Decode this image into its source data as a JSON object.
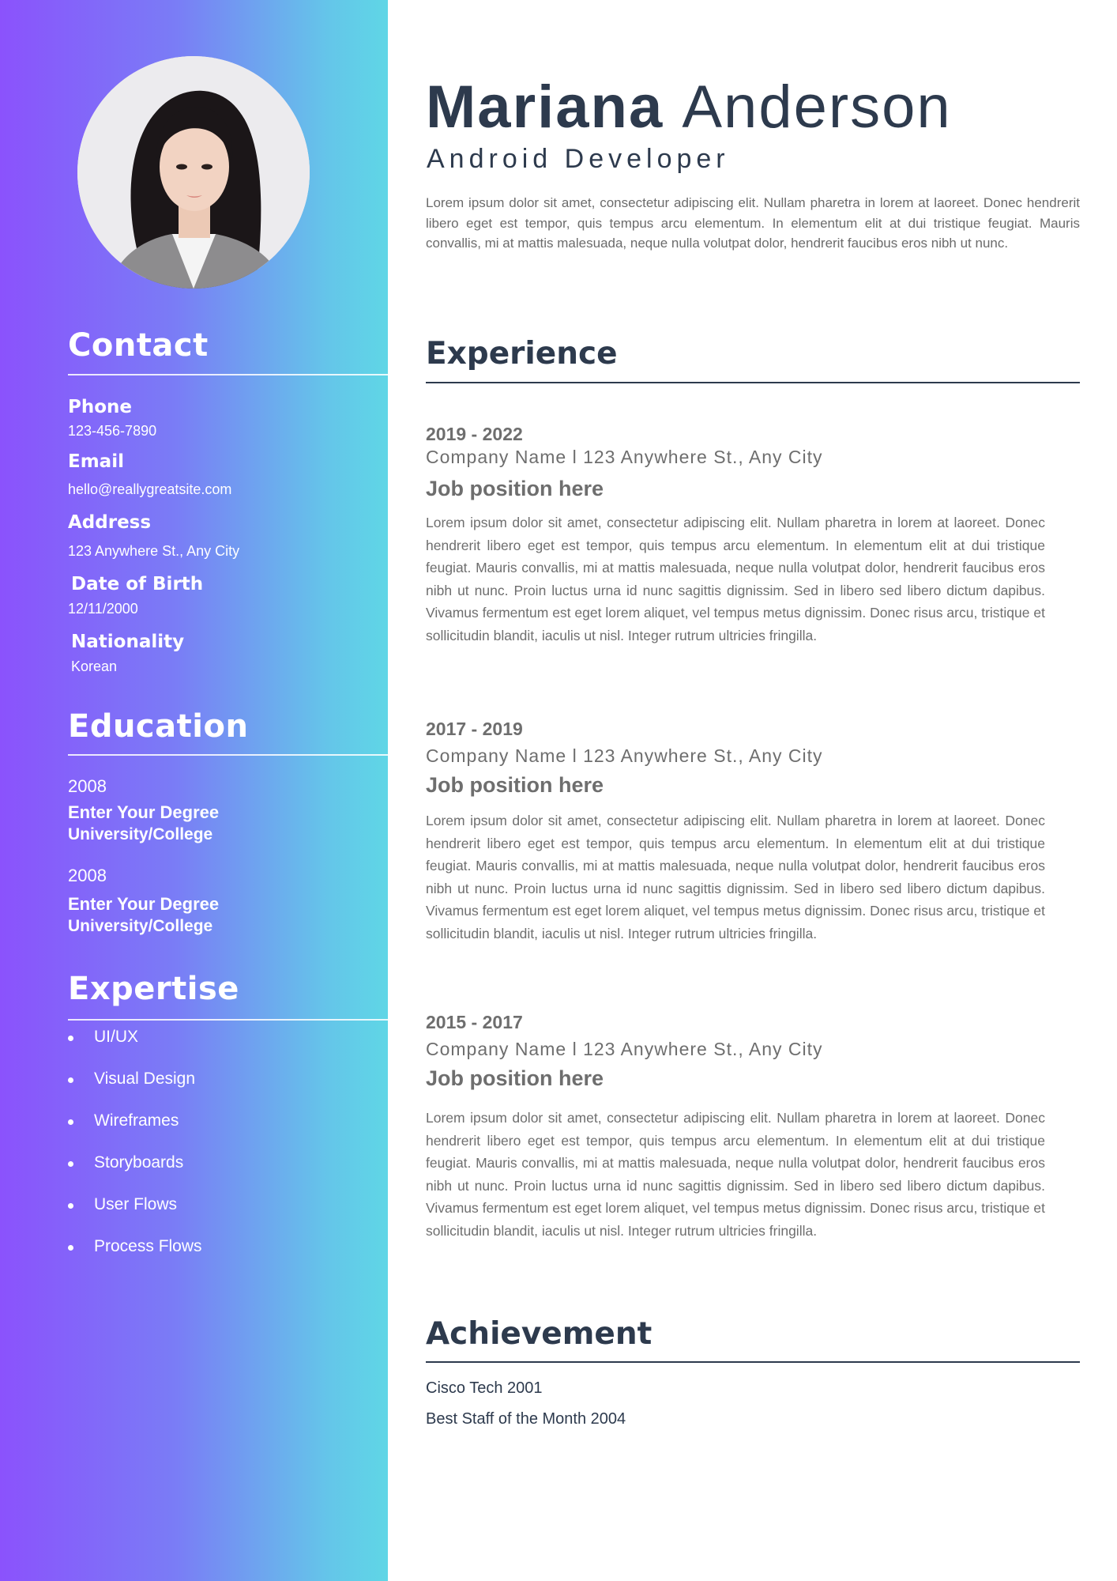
{
  "profile": {
    "first_name": "Mariana",
    "last_name": "Anderson",
    "role": "Android Developer",
    "summary": "Lorem ipsum dolor sit amet, consectetur adipiscing elit. Nullam pharetra in lorem at laoreet. Donec hendrerit libero eget est tempor, quis tempus arcu elementum. In elementum elit at dui tristique feugiat. Mauris convallis, mi at mattis malesuada, neque nulla volutpat dolor, hendrerit faucibus eros nibh ut nunc."
  },
  "contact": {
    "title": "Contact",
    "phone_label": "Phone",
    "phone": "123-456-7890",
    "email_label": "Email",
    "email": "hello@reallygreatsite.com",
    "address_label": "Address",
    "address": "123 Anywhere St., Any City",
    "dob_label": "Date of Birth",
    "dob": "12/11/2000",
    "nationality_label": "Nationality",
    "nationality": "Korean"
  },
  "education": {
    "title": "Education",
    "items": [
      {
        "year": "2008",
        "degree": "Enter Your Degree",
        "school": "University/College"
      },
      {
        "year": "2008",
        "degree": "Enter Your Degree",
        "school": "University/College"
      }
    ]
  },
  "expertise": {
    "title": "Expertise",
    "items": [
      "UI/UX",
      "Visual Design",
      "Wireframes",
      "Storyboards",
      "User Flows",
      "Process Flows"
    ]
  },
  "experience": {
    "title": "Experience",
    "jobs": [
      {
        "years": "2019 - 2022",
        "company": "Company Name l 123 Anywhere St., Any City",
        "position": "Job position here",
        "description": "Lorem ipsum dolor sit amet, consectetur adipiscing elit. Nullam pharetra in lorem at laoreet. Donec hendrerit libero eget est tempor, quis tempus arcu elementum. In elementum elit at dui tristique feugiat. Mauris convallis, mi at mattis malesuada, neque nulla volutpat dolor, hendrerit faucibus eros nibh ut nunc. Proin luctus urna id nunc sagittis dignissim. Sed in libero sed libero dictum dapibus. Vivamus fermentum est eget lorem aliquet, vel tempus metus dignissim. Donec risus arcu, tristique et sollicitudin blandit, iaculis ut nisl. Integer rutrum ultricies fringilla."
      },
      {
        "years": "2017 - 2019",
        "company": "Company Name l 123 Anywhere St., Any City",
        "position": "Job position here",
        "description": "Lorem ipsum dolor sit amet, consectetur adipiscing elit. Nullam pharetra in lorem at laoreet. Donec hendrerit libero eget est tempor, quis tempus arcu elementum. In elementum elit at dui tristique feugiat. Mauris convallis, mi at mattis malesuada, neque nulla volutpat dolor, hendrerit faucibus eros nibh ut nunc. Proin luctus urna id nunc sagittis dignissim. Sed in libero sed libero dictum dapibus. Vivamus fermentum est eget lorem aliquet, vel tempus metus dignissim. Donec risus arcu, tristique et sollicitudin blandit, iaculis ut nisl. Integer rutrum ultricies fringilla."
      },
      {
        "years": "2015 - 2017",
        "company": "Company Name l 123 Anywhere St., Any City",
        "position": "Job position here",
        "description": "Lorem ipsum dolor sit amet, consectetur adipiscing elit. Nullam pharetra in lorem at laoreet. Donec hendrerit libero eget est tempor, quis tempus arcu elementum. In elementum elit at dui tristique feugiat. Mauris convallis, mi at mattis malesuada, neque nulla volutpat dolor, hendrerit faucibus eros nibh ut nunc. Proin luctus urna id nunc sagittis dignissim. Sed in libero sed libero dictum dapibus. Vivamus fermentum est eget lorem aliquet, vel tempus metus dignissim. Donec risus arcu, tristique et sollicitudin blandit, iaculis ut nisl. Integer rutrum ultricies fringilla."
      }
    ]
  },
  "achievement": {
    "title": "Achievement",
    "items": [
      "Cisco Tech 2001",
      "Best Staff of the Month 2004"
    ]
  },
  "colors": {
    "gradient_start": "#8b52fc",
    "gradient_end": "#5fd6e6",
    "heading": "#2d3a4d",
    "body_text": "#6e6e6e"
  }
}
